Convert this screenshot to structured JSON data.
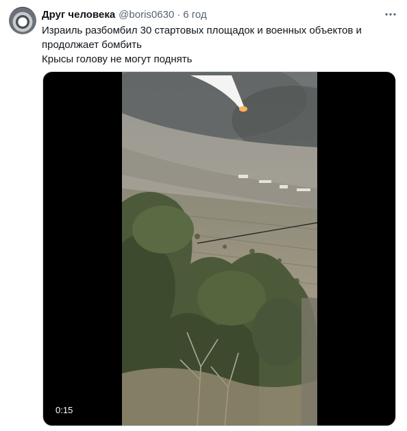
{
  "tweet": {
    "author_name": "Друг человека",
    "handle": "@boris0630",
    "separator": "·",
    "time": "6 год",
    "text_line1": "Израиль разбомбил 30 стартовых площадок и военных объектов и продолжает бомбить",
    "text_line2": "Крысы голову не могут поднять",
    "video_duration": "0:15"
  },
  "icons": {
    "more": "more-horizontal-icon",
    "avatar": "avatar-image"
  },
  "colors": {
    "primary_text": "#0f1419",
    "secondary_text": "#536471",
    "media_background": "#000000",
    "border": "#cfd9de"
  }
}
